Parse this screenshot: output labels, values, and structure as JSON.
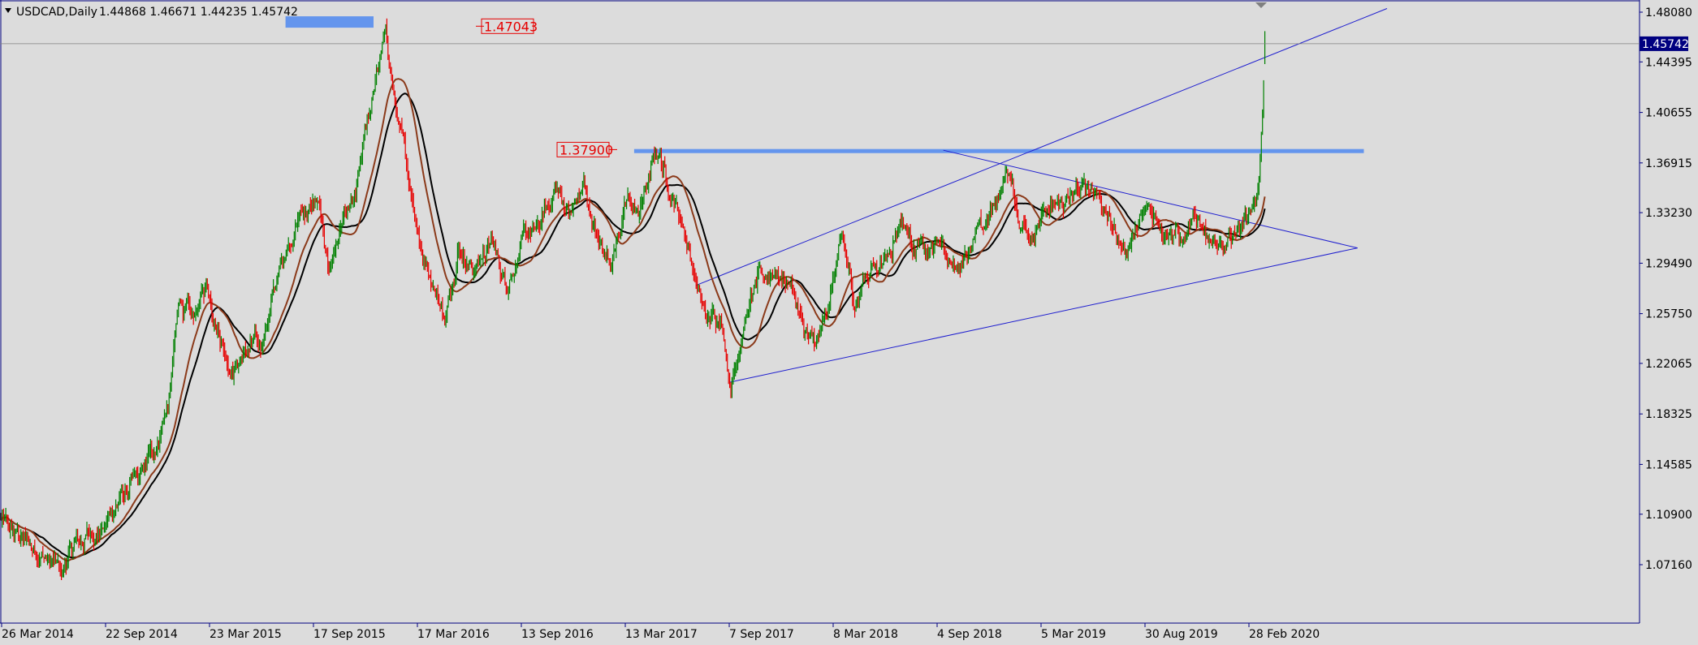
{
  "header": {
    "symbol_label": "USDCAD,Daily",
    "ohlc_label": "1.44868 1.46671 1.44235 1.45742"
  },
  "chart_data": {
    "type": "candlestick",
    "symbol": "USDCAD",
    "timeframe": "Daily",
    "ohlc_last": {
      "open": 1.44868,
      "high": 1.46671,
      "low": 1.44235,
      "close": 1.45742
    },
    "last_price_label": "1.45742",
    "ylim": [
      1.05,
      1.487
    ],
    "y_ticks": [
      "1.48080",
      "1.44395",
      "1.40655",
      "1.36915",
      "1.33230",
      "1.29490",
      "1.25750",
      "1.22065",
      "1.18325",
      "1.14585",
      "1.10900",
      "1.07160"
    ],
    "x_ticks": [
      "26 Mar 2014",
      "22 Sep 2014",
      "23 Mar 2015",
      "17 Sep 2015",
      "17 Mar 2016",
      "13 Sep 2016",
      "13 Mar 2017",
      "7 Sep 2017",
      "8 Mar 2018",
      "4 Sep 2018",
      "5 Mar 2019",
      "30 Aug 2019",
      "28 Feb 2020"
    ],
    "x_range": [
      "2014-03-26",
      "2020-12-31"
    ],
    "price_path": [
      [
        "2014-03-26",
        1.105
      ],
      [
        "2014-04-15",
        1.095
      ],
      [
        "2014-05-05",
        1.09
      ],
      [
        "2014-06-01",
        1.082
      ],
      [
        "2014-06-20",
        1.075
      ],
      [
        "2014-07-10",
        1.066
      ],
      [
        "2014-07-31",
        1.085
      ],
      [
        "2014-08-20",
        1.092
      ],
      [
        "2014-09-22",
        1.1
      ],
      [
        "2014-10-20",
        1.12
      ],
      [
        "2014-11-20",
        1.135
      ],
      [
        "2014-12-20",
        1.16
      ],
      [
        "2015-01-12",
        1.195
      ],
      [
        "2015-01-30",
        1.27
      ],
      [
        "2015-02-20",
        1.25
      ],
      [
        "2015-03-18",
        1.28
      ],
      [
        "2015-04-05",
        1.25
      ],
      [
        "2015-05-01",
        1.215
      ],
      [
        "2015-05-25",
        1.23
      ],
      [
        "2015-06-20",
        1.235
      ],
      [
        "2015-07-10",
        1.27
      ],
      [
        "2015-08-01",
        1.305
      ],
      [
        "2015-08-25",
        1.33
      ],
      [
        "2015-09-25",
        1.34
      ],
      [
        "2015-10-15",
        1.29
      ],
      [
        "2015-11-05",
        1.32
      ],
      [
        "2015-11-30",
        1.34
      ],
      [
        "2015-12-20",
        1.4
      ],
      [
        "2016-01-20",
        1.465
      ],
      [
        "2016-02-10",
        1.4
      ],
      [
        "2016-03-05",
        1.35
      ],
      [
        "2016-03-25",
        1.3
      ],
      [
        "2016-04-15",
        1.28
      ],
      [
        "2016-05-03",
        1.252
      ],
      [
        "2016-05-25",
        1.31
      ],
      [
        "2016-06-20",
        1.29
      ],
      [
        "2016-07-20",
        1.31
      ],
      [
        "2016-08-15",
        1.28
      ],
      [
        "2016-09-13",
        1.31
      ],
      [
        "2016-10-10",
        1.32
      ],
      [
        "2016-11-10",
        1.35
      ],
      [
        "2016-12-05",
        1.33
      ],
      [
        "2016-12-28",
        1.352
      ],
      [
        "2017-01-20",
        1.31
      ],
      [
        "2017-02-15",
        1.3
      ],
      [
        "2017-03-13",
        1.34
      ],
      [
        "2017-04-01",
        1.33
      ],
      [
        "2017-04-25",
        1.365
      ],
      [
        "2017-05-05",
        1.379
      ],
      [
        "2017-05-30",
        1.345
      ],
      [
        "2017-06-20",
        1.32
      ],
      [
        "2017-07-10",
        1.28
      ],
      [
        "2017-07-30",
        1.25
      ],
      [
        "2017-08-20",
        1.26
      ],
      [
        "2017-09-08",
        1.206
      ],
      [
        "2017-09-30",
        1.25
      ],
      [
        "2017-10-25",
        1.28
      ],
      [
        "2017-11-20",
        1.29
      ],
      [
        "2017-12-20",
        1.28
      ],
      [
        "2018-01-10",
        1.245
      ],
      [
        "2018-02-01",
        1.23
      ],
      [
        "2018-02-25",
        1.27
      ],
      [
        "2018-03-19",
        1.31
      ],
      [
        "2018-04-10",
        1.265
      ],
      [
        "2018-05-05",
        1.29
      ],
      [
        "2018-06-05",
        1.3
      ],
      [
        "2018-06-28",
        1.33
      ],
      [
        "2018-07-20",
        1.31
      ],
      [
        "2018-08-15",
        1.3
      ],
      [
        "2018-09-04",
        1.31
      ],
      [
        "2018-09-30",
        1.29
      ],
      [
        "2018-10-25",
        1.31
      ],
      [
        "2018-11-20",
        1.32
      ],
      [
        "2018-12-31",
        1.365
      ],
      [
        "2019-01-20",
        1.325
      ],
      [
        "2019-02-15",
        1.32
      ],
      [
        "2019-03-05",
        1.33
      ],
      [
        "2019-04-10",
        1.34
      ],
      [
        "2019-05-10",
        1.35
      ],
      [
        "2019-05-31",
        1.352
      ],
      [
        "2019-06-20",
        1.33
      ],
      [
        "2019-07-19",
        1.305
      ],
      [
        "2019-08-10",
        1.32
      ],
      [
        "2019-08-30",
        1.335
      ],
      [
        "2019-09-20",
        1.325
      ],
      [
        "2019-10-15",
        1.32
      ],
      [
        "2019-11-01",
        1.31
      ],
      [
        "2019-11-25",
        1.33
      ],
      [
        "2019-12-15",
        1.315
      ],
      [
        "2020-01-06",
        1.3
      ],
      [
        "2020-01-30",
        1.32
      ],
      [
        "2020-02-28",
        1.34
      ],
      [
        "2020-03-09",
        1.36
      ],
      [
        "2020-03-12",
        1.39
      ],
      [
        "2020-03-16",
        1.42
      ],
      [
        "2020-03-18",
        1.4574
      ]
    ],
    "moving_averages": [
      {
        "color": "#000000",
        "lag_days": 75
      },
      {
        "color": "#8b3a1a",
        "lag_days": 55
      }
    ],
    "annotations": {
      "level_high": {
        "label": "1.47043",
        "price": 1.47043
      },
      "level_mid": {
        "label": "1.37900",
        "price": 1.379
      },
      "zone_high": {
        "date_from": "2015-08-01",
        "date_to": "2015-12-31",
        "price_center": 1.4735
      },
      "resistance_band": {
        "date_from": "2017-03-25",
        "date_to": "2020-09-05",
        "price": 1.3779
      },
      "channel_upper": [
        [
          "2017-07-10",
          1.2785
        ],
        [
          "2020-10-15",
          1.4835
        ]
      ],
      "channel_lower": [
        [
          "2017-09-05",
          1.2066
        ],
        [
          "2020-08-25",
          1.3062
        ]
      ],
      "triangle_upper": [
        [
          "2018-09-10",
          1.3785
        ],
        [
          "2020-08-25",
          1.3062
        ]
      ]
    },
    "colors": {
      "bull": "#008000",
      "bear": "#e60000",
      "bg": "#dcdcdc",
      "trend_line": "#1f1fcf",
      "level_fill": "#6495ed",
      "label": "#e60000",
      "price_tag": "#000080"
    },
    "grid": false
  }
}
